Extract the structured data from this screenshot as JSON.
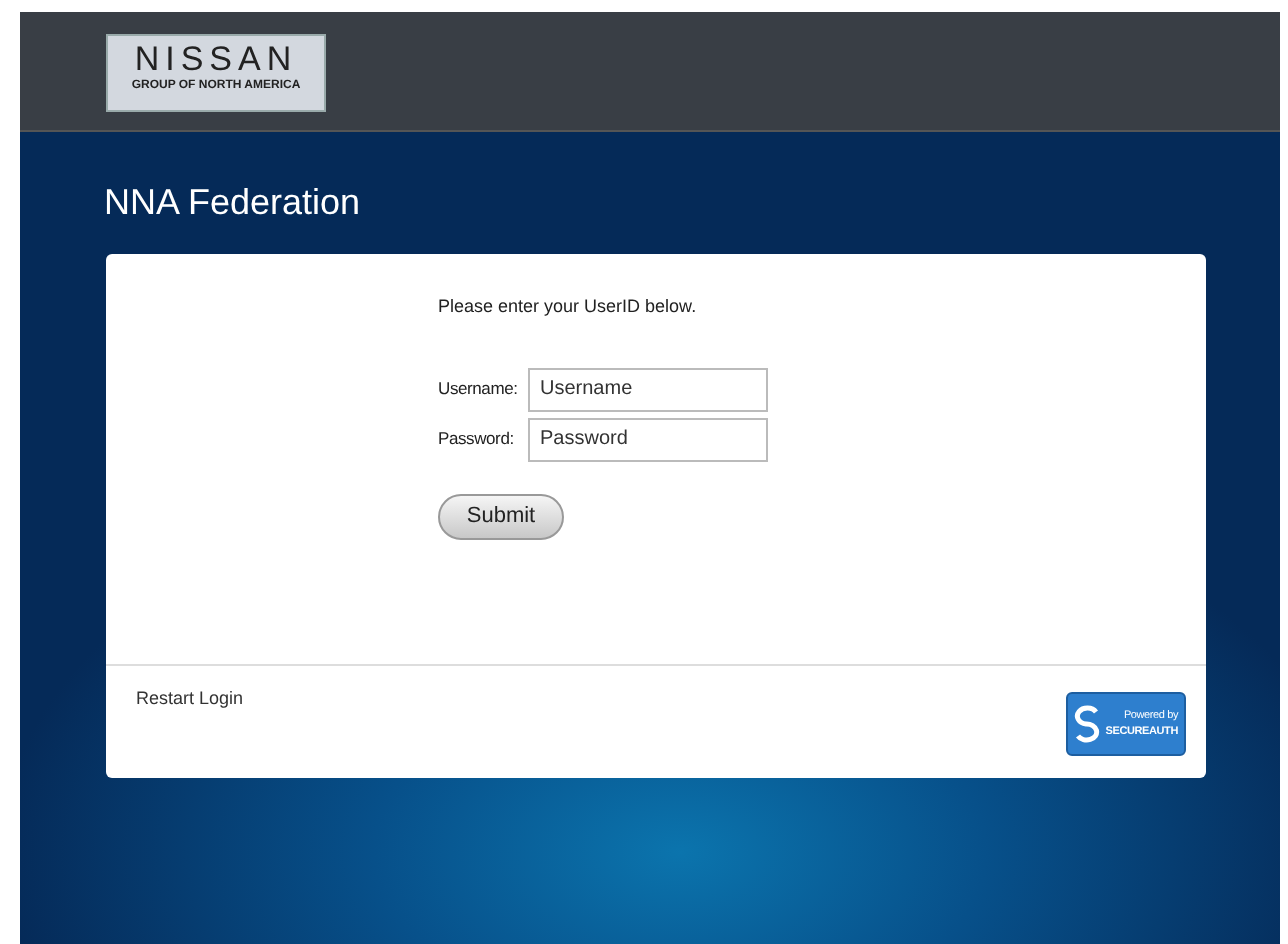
{
  "header": {
    "logo": {
      "brand": "NISSAN",
      "subtitle": "GROUP OF NORTH AMERICA"
    }
  },
  "page_title": "NNA Federation",
  "login": {
    "instruction": "Please enter your UserID below.",
    "fields": [
      {
        "label": "Username:",
        "placeholder": "Username"
      },
      {
        "label": "Password:",
        "placeholder": "Password"
      }
    ],
    "submit": "Submit"
  },
  "footer": {
    "link": "Restart Login",
    "badge": {
      "line_1": "Powered by",
      "line_2": "SECUREAUTH"
    }
  }
}
